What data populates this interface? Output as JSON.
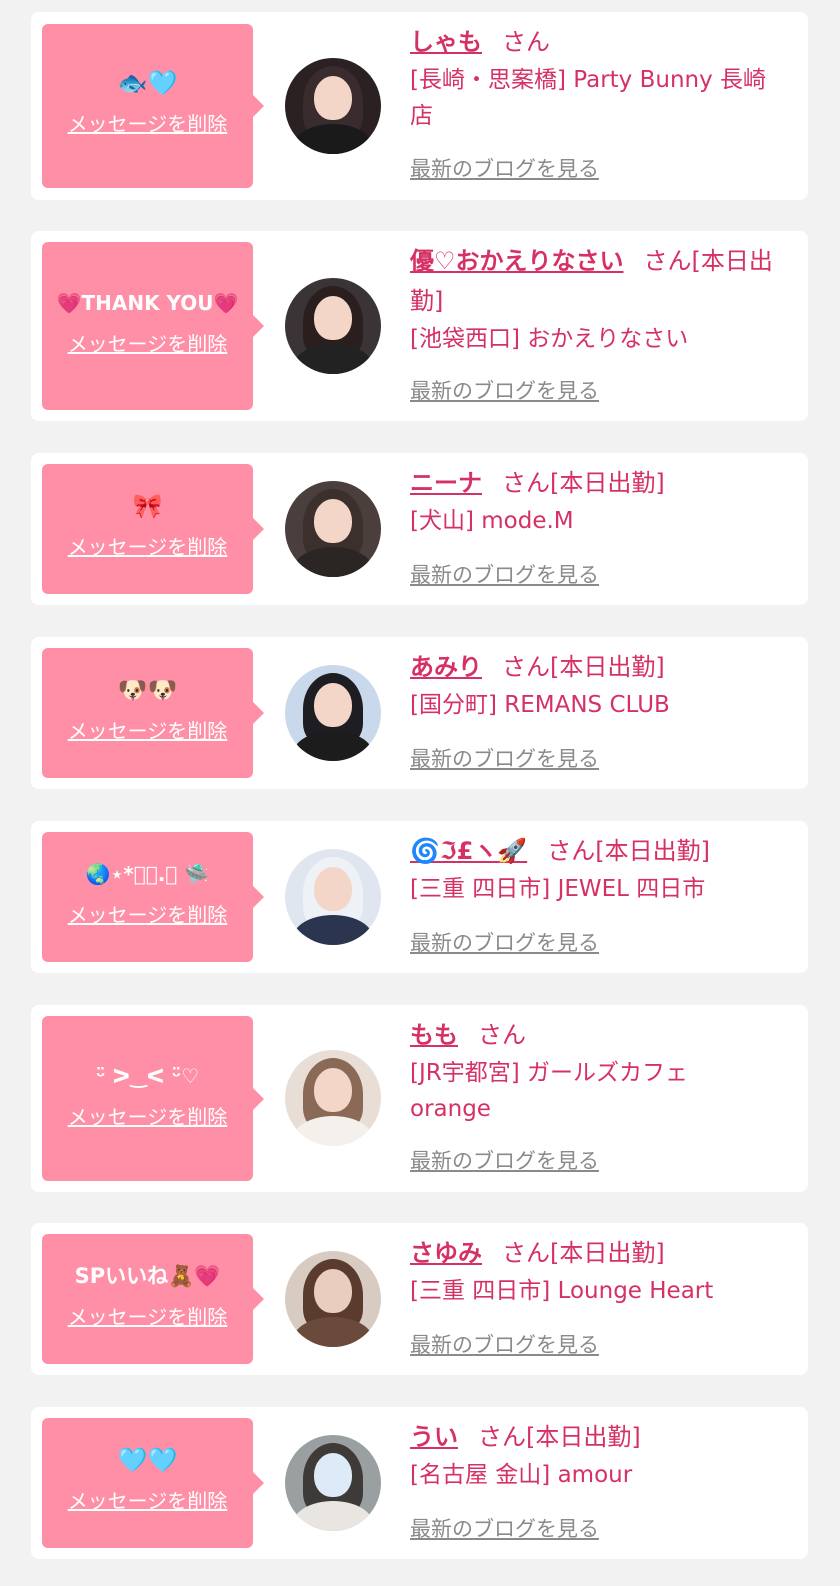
{
  "delete_label": "メッセージを削除",
  "blog_label": "最新のブログを見る",
  "san_label": "さん",
  "colors": {
    "bubble": "#ff8fa6",
    "accent": "#d63164",
    "link_gray": "#8a8a8a",
    "background": "#f2f2f2"
  },
  "items": [
    {
      "message": "🐟🩵",
      "name": "しゃも",
      "status": "",
      "shop": "[長崎・思案橋] Party Bunny 長崎店"
    },
    {
      "message": "💗THANK YOU💗",
      "name": "優♡おかえりなさい",
      "status": "[本日出勤]",
      "shop": "[池袋西口] おかえりなさい"
    },
    {
      "message": "🎀",
      "name": "ニーナ",
      "status": "[本日出勤]",
      "shop": "[犬山] mode.M"
    },
    {
      "message": "🐶🐶",
      "name": "あみり",
      "status": "[本日出勤]",
      "shop": "[国分町] REMANS CLUB"
    },
    {
      "message": "🌏⋆*ﾟ･.｡ 🛸",
      "name": "🌀ℑ£ヽ🚀",
      "status": "[本日出勤]",
      "shop": "[三重 四日市] JEWEL 四日市"
    },
    {
      "message": "ᵕ̈ ᐳ‿ᐸ ᵕ̈♡",
      "name": "もも",
      "status": "",
      "shop": "[JR宇都宮] ガールズカフェ orange"
    },
    {
      "message": "SPいいね🧸💗",
      "name": "さゆみ",
      "status": "[本日出勤]",
      "shop": "[三重 四日市] Lounge Heart"
    },
    {
      "message": "🩵🩵",
      "name": "うい",
      "status": "[本日出勤]",
      "shop": "[名古屋 金山] amour"
    }
  ]
}
